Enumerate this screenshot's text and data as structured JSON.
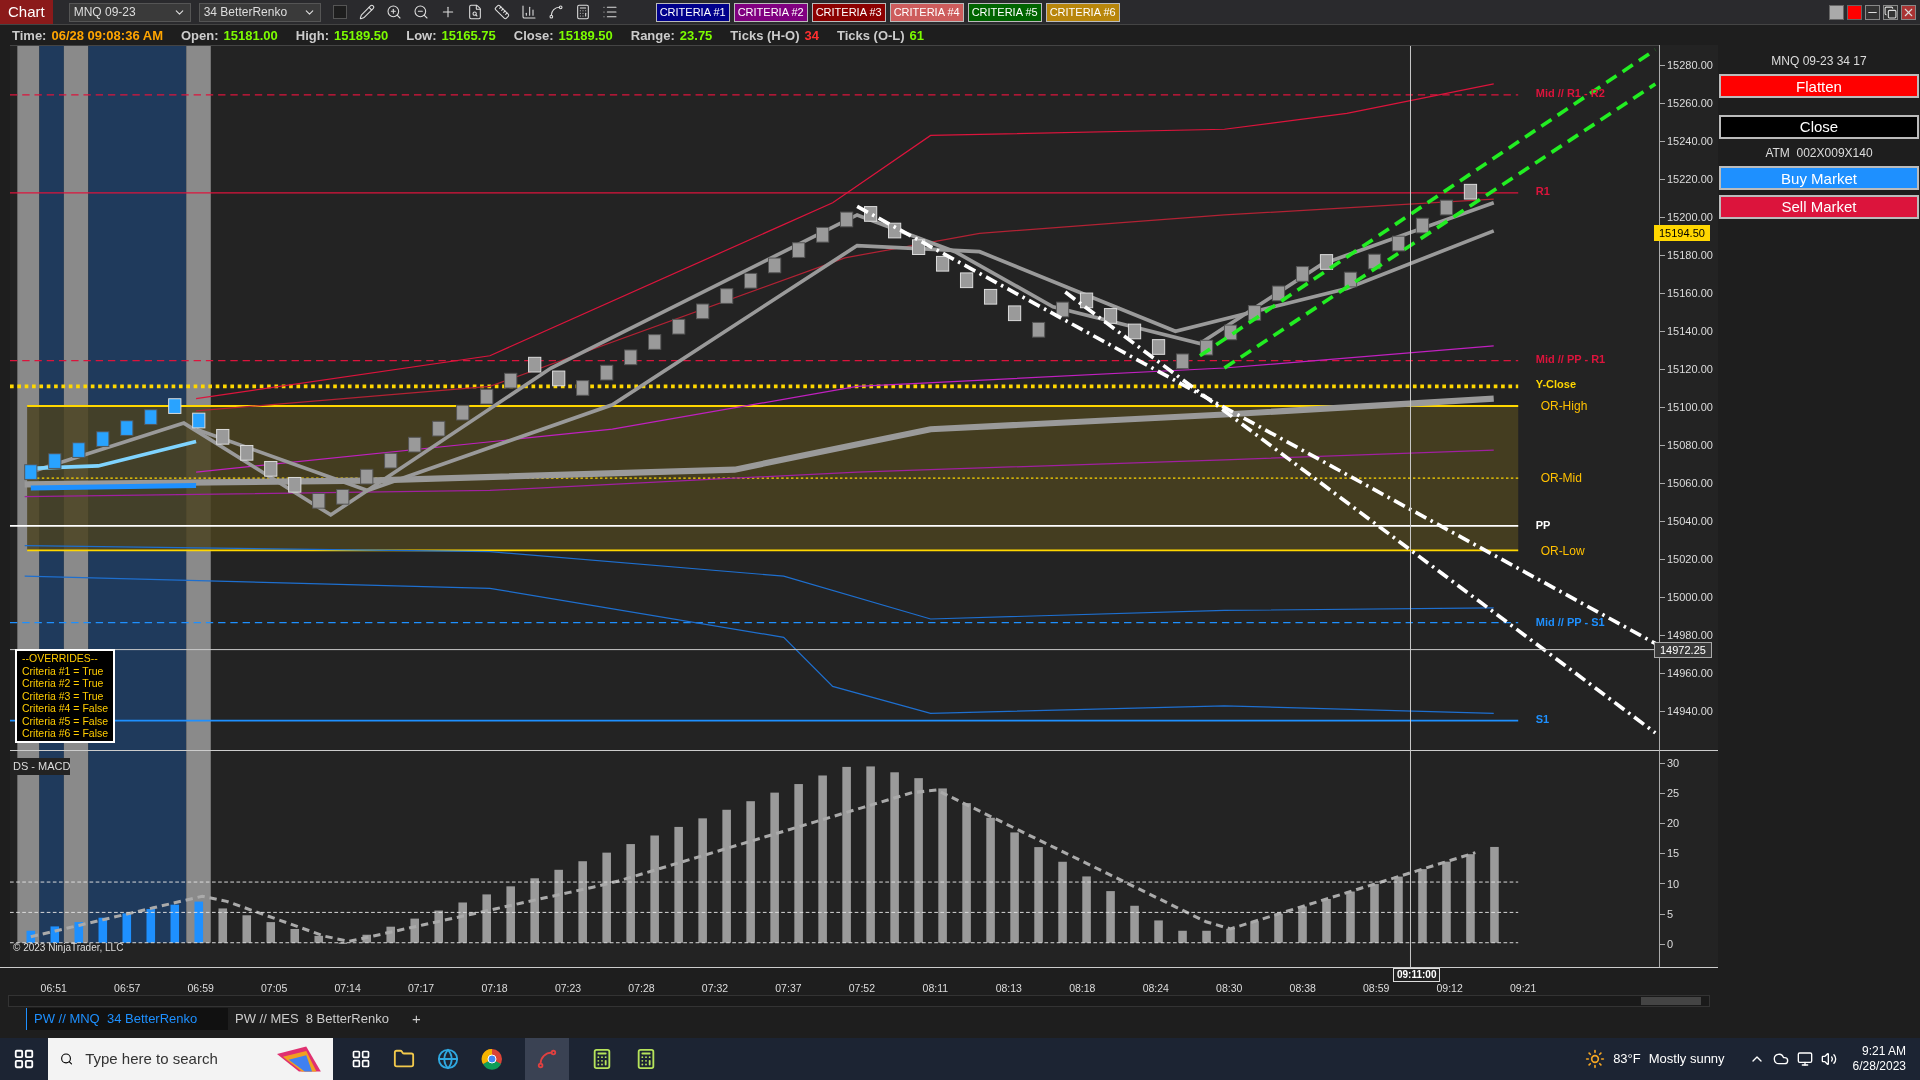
{
  "toolbar": {
    "title": "Chart",
    "instrument": "MNQ 09-23",
    "bar_type": "34 BetterRenko",
    "criteria": [
      {
        "label": "CRITERIA #1",
        "color": "#00008b"
      },
      {
        "label": "CRITERIA #2",
        "color": "#800080"
      },
      {
        "label": "CRITERIA #3",
        "color": "#8b0000"
      },
      {
        "label": "CRITERIA #4",
        "color": "#cd5c5c"
      },
      {
        "label": "CRITERIA #5",
        "color": "#006400"
      },
      {
        "label": "CRITERIA #6",
        "color": "#b8860b"
      }
    ]
  },
  "info_bar": [
    {
      "label": "Time:",
      "value": "06/28 09:08:36 AM",
      "color": "#ffa500"
    },
    {
      "label": "Open:",
      "value": "15181.00",
      "color": "#7cfc00"
    },
    {
      "label": "High:",
      "value": "15189.50",
      "color": "#7cfc00"
    },
    {
      "label": "Low:",
      "value": "15165.75",
      "color": "#7cfc00"
    },
    {
      "label": "Close:",
      "value": "15189.50",
      "color": "#7cfc00"
    },
    {
      "label": "Range:",
      "value": "23.75",
      "color": "#7cfc00"
    },
    {
      "label": "Ticks (H-O)",
      "value": "34",
      "color": "#ff3030"
    },
    {
      "label": "Ticks (O-L)",
      "value": "61",
      "color": "#7cfc00"
    }
  ],
  "price_panel": {
    "price_axis": [
      "15280.00",
      "15260.00",
      "15240.00",
      "15220.00",
      "15200.00",
      "15180.00",
      "15160.00",
      "15140.00",
      "15120.00",
      "15100.00",
      "15080.00",
      "15060.00",
      "15040.00",
      "15020.00",
      "15000.00",
      "14980.00",
      "14960.00",
      "14940.00"
    ],
    "last_price": "15194.50",
    "crosshair_price": "14972.25",
    "levels": [
      {
        "label": "Mid // R1 - R2",
        "color": "#dc143c"
      },
      {
        "label": "R1",
        "color": "#dc143c"
      },
      {
        "label": "Mid // PP - R1",
        "color": "#dc143c"
      },
      {
        "label": "Y-Close",
        "color": "#ffd700"
      },
      {
        "label": "OR-High",
        "color": "#ffc000"
      },
      {
        "label": "OR-Mid",
        "color": "#ffc000"
      },
      {
        "label": "PP",
        "color": "#ffffff"
      },
      {
        "label": "OR-Low",
        "color": "#ffc000"
      },
      {
        "label": "Mid // PP - S1",
        "color": "#1e90ff"
      },
      {
        "label": "S1",
        "color": "#1e90ff"
      }
    ],
    "overrides": {
      "title": "--OVERRIDES--",
      "lines": [
        "Criteria #1 = True",
        "Criteria #2 = True",
        "Criteria #3 = True",
        "Criteria #4 = False",
        "Criteria #5 = False",
        "Criteria #6 = False"
      ]
    }
  },
  "macd_panel": {
    "title": "DS - MACD",
    "axis": [
      "30",
      "25",
      "20",
      "15",
      "10",
      "5",
      "0"
    ],
    "copyright": "© 2023 NinjaTrader, LLC"
  },
  "time_axis": {
    "labels": [
      "06:51",
      "06:57",
      "06:59",
      "07:05",
      "07:14",
      "07:17",
      "07:18",
      "07:23",
      "07:28",
      "07:32",
      "07:37",
      "07:52",
      "08:11",
      "08:13",
      "08:18",
      "08:24",
      "08:30",
      "08:38",
      "08:59",
      "09:12",
      "09:21"
    ],
    "crosshair_time": "09:11:00"
  },
  "order_panel": {
    "account": "MNQ 09-23 34 17",
    "atm": "ATM  002X009X140",
    "buttons": [
      {
        "label": "Flatten",
        "kind": "flatten"
      },
      {
        "label": "Close",
        "kind": "close"
      },
      {
        "label": "Buy Market",
        "kind": "buy"
      },
      {
        "label": "Sell Market",
        "kind": "sell"
      }
    ]
  },
  "tabs": [
    {
      "label": "PW // MNQ  34 BetterRenko",
      "selected": true
    },
    {
      "label": "PW // MES  8 BetterRenko",
      "selected": false
    }
  ],
  "add_tab": "+",
  "taskbar": {
    "search_placeholder": "Type here to search",
    "weather": "83°F",
    "weather_text": "Mostly sunny",
    "time": "9:21 AM",
    "date": "6/28/2023"
  }
}
